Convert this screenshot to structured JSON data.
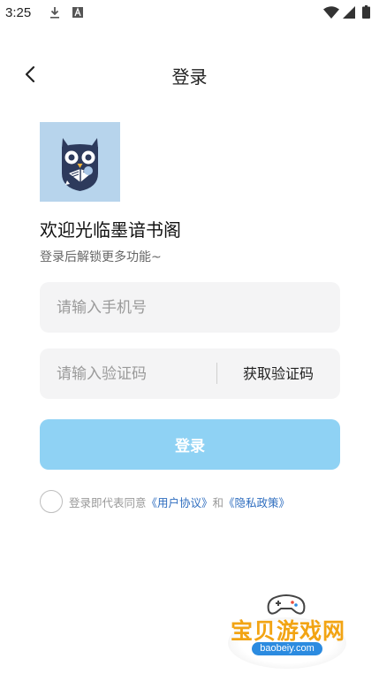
{
  "status_bar": {
    "time": "3:25",
    "icons": [
      "download-icon",
      "font-icon",
      "wifi-icon",
      "signal-icon",
      "battery-icon"
    ]
  },
  "header": {
    "title": "登录",
    "back_icon": "chevron-left-icon"
  },
  "welcome": {
    "title": "欢迎光临墨谙书阁",
    "subtitle": "登录后解锁更多功能~"
  },
  "form": {
    "phone_placeholder": "请输入手机号",
    "phone_value": "",
    "code_placeholder": "请输入验证码",
    "code_value": "",
    "get_code_label": "获取验证码",
    "login_label": "登录"
  },
  "agreement": {
    "checked": false,
    "prefix": "登录即代表同意",
    "user_agreement": "《用户协议》",
    "and": "和",
    "privacy_policy": "《隐私政策》"
  },
  "watermark": {
    "title": "宝贝游戏网",
    "domain": "baobeiy.com"
  },
  "colors": {
    "logo_bg": "#b7d4ec",
    "login_button": "#8fd2f4",
    "link": "#2e6dbf",
    "input_bg": "#f4f4f5",
    "watermark_orange": "#f2a413",
    "watermark_blue": "#2b8be0"
  }
}
